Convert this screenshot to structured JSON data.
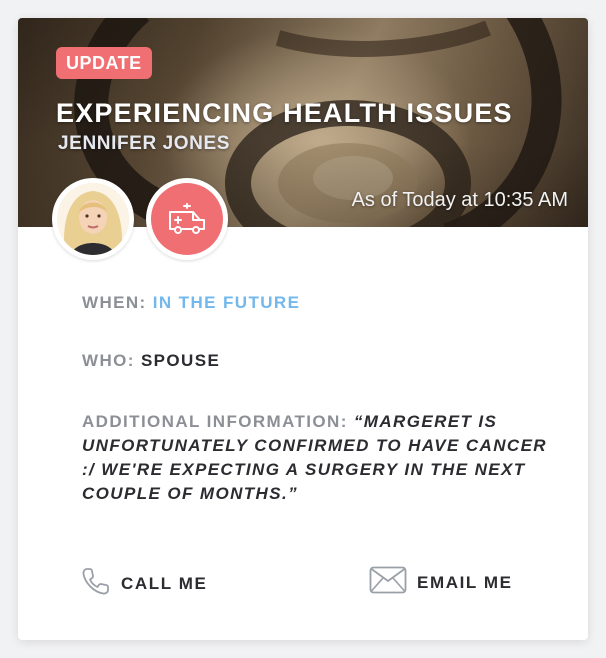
{
  "card": {
    "badge": "UPDATE",
    "title": "EXPERIENCING HEALTH ISSUES",
    "person_name": "JENNIFER JONES",
    "timestamp": "As of Today at 10:35 AM",
    "avatar_icon": "user-avatar",
    "category_icon": "ambulance-icon",
    "accent_color": "#ef6f72",
    "link_color": "#72b8ec"
  },
  "details": {
    "when_label": "WHEN:",
    "when_value": "IN THE FUTURE",
    "who_label": "WHO:",
    "who_value": "SPOUSE",
    "info_label": "ADDITIONAL INFORMATION:",
    "info_value": "“MARGERET IS UNFORTUNATELY CONFIRMED TO HAVE CANCER :/ WE'RE EXPECTING A SURGERY IN THE NEXT COUPLE OF MONTHS.”"
  },
  "actions": {
    "call_label": "CALL ME",
    "call_icon": "phone-icon",
    "email_label": "EMAIL ME",
    "email_icon": "envelope-icon"
  }
}
